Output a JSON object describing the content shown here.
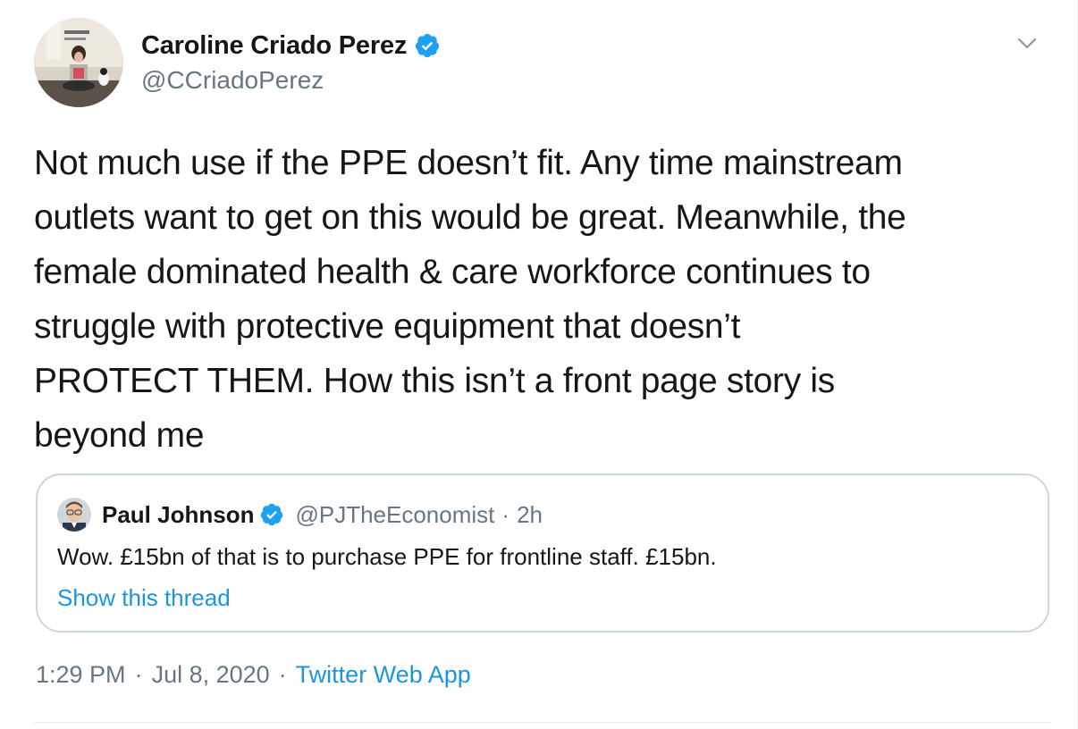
{
  "author": {
    "display_name": "Caroline Criado Perez",
    "handle": "@CCriadoPerez",
    "verified": true,
    "avatar_icon": "profile-photo-woman-reading-with-dog"
  },
  "tweet": {
    "text": "Not much use if the PPE doesn’t fit. Any time mainstream\noutlets want to get on this would be great. Meanwhile, the\nfemale dominated health & care workforce continues to\nstruggle with protective equipment that doesn’t\nPROTECT THEM. How this isn’t a front page story is\nbeyond me"
  },
  "quoted_tweet": {
    "display_name": "Paul Johnson",
    "handle": "@PJTheEconomist",
    "separator": "·",
    "time_ago": "2h",
    "verified": true,
    "text": "Wow. £15bn of that is to purchase PPE for frontline staff. £15bn.",
    "thread_link": "Show this thread"
  },
  "footer": {
    "time": "1:29 PM",
    "separator": "·",
    "date": "Jul 8, 2020",
    "source": "Twitter Web App"
  },
  "colors": {
    "text_primary": "#14171a",
    "text_secondary": "#657786",
    "link": "#1b95e0",
    "verified_badge": "#1da1f2",
    "border": "#ccd6dd"
  },
  "icons": {
    "verified": "verified-badge-icon",
    "menu": "chevron-down-icon"
  }
}
